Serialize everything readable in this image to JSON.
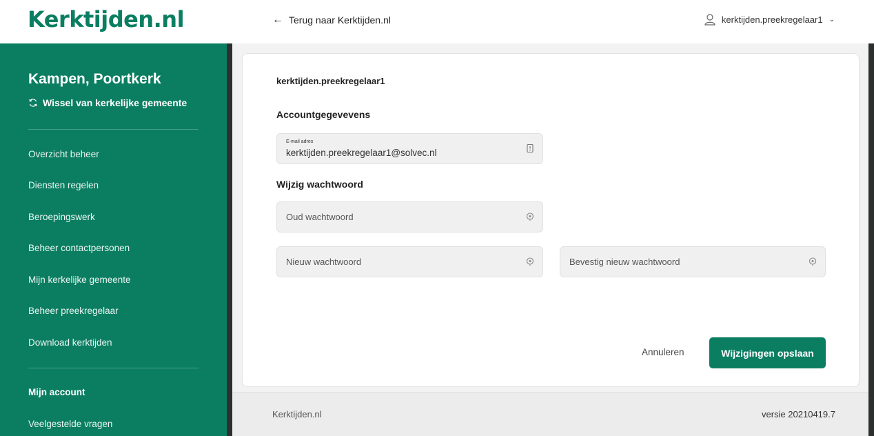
{
  "header": {
    "logo": "Kerktijden.nl",
    "back_label": "Terug naar Kerktijden.nl",
    "user_label": "kerktijden.preekregelaar1"
  },
  "sidebar": {
    "church_name": "Kampen, Poortkerk",
    "switch_label": "Wissel van kerkelijke gemeente",
    "items": [
      {
        "label": "Overzicht beheer"
      },
      {
        "label": "Diensten regelen"
      },
      {
        "label": "Beroepingswerk"
      },
      {
        "label": "Beheer contactpersonen"
      },
      {
        "label": "Mijn kerkelijke gemeente"
      },
      {
        "label": "Beheer preekregelaar"
      },
      {
        "label": "Download kerktijden"
      },
      {
        "label": "Mijn account",
        "active": true
      },
      {
        "label": "Veelgestelde vragen"
      }
    ]
  },
  "account": {
    "username": "kerktijden.preekregelaar1",
    "section_account": "Accountgegevevens",
    "email_label": "E-mail adres",
    "email_value": "kerktijden.preekregelaar1@solvec.nl",
    "section_password": "Wijzig wachtwoord",
    "old_password_placeholder": "Oud wachtwoord",
    "new_password_placeholder": "Nieuw wachtwoord",
    "confirm_password_placeholder": "Bevestig nieuw wachtwoord",
    "cancel_label": "Annuleren",
    "save_label": "Wijzigingen opslaan"
  },
  "footer": {
    "left": "Kerktijden.nl",
    "version": "versie 20210419.7"
  },
  "colors": {
    "brand": "#0b7e62",
    "sidebar_edge": "#2b2f2e"
  },
  "icons": {
    "back": "arrow-left-icon",
    "user": "user-icon",
    "switch": "refresh-icon",
    "email_field": "id-card-icon",
    "password_field": "eye-icon"
  }
}
